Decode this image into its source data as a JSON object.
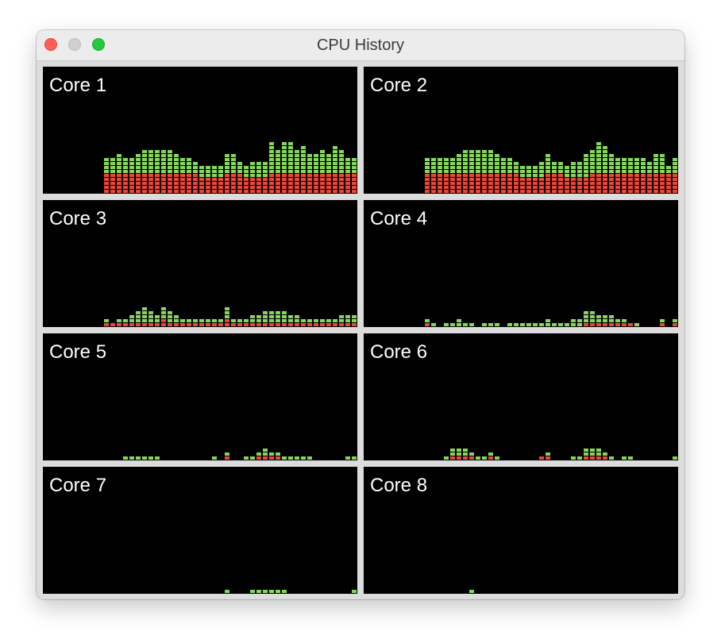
{
  "window": {
    "title": "CPU History"
  },
  "colors": {
    "user": "#86d65a",
    "system": "#e8473a",
    "background": "#000000"
  },
  "cores": [
    {
      "label": "Core 1",
      "system": [
        0,
        0,
        0,
        0,
        0,
        0,
        0,
        0,
        0,
        0,
        0,
        5,
        5,
        5,
        5,
        5,
        5,
        5,
        5,
        5,
        5,
        5,
        5,
        5,
        5,
        5,
        4,
        4,
        4,
        4,
        5,
        5,
        5,
        4,
        4,
        4,
        4,
        5,
        5,
        5,
        5,
        5,
        5,
        5,
        5,
        5,
        5,
        5,
        5,
        5,
        5
      ],
      "user": [
        0,
        0,
        0,
        0,
        0,
        0,
        0,
        0,
        0,
        0,
        0,
        4,
        4,
        5,
        4,
        4,
        5,
        6,
        6,
        6,
        6,
        6,
        5,
        4,
        4,
        3,
        3,
        3,
        3,
        3,
        5,
        5,
        3,
        3,
        4,
        4,
        4,
        8,
        6,
        8,
        8,
        6,
        7,
        5,
        5,
        6,
        5,
        7,
        6,
        4,
        4
      ]
    },
    {
      "label": "Core 2",
      "system": [
        0,
        0,
        0,
        0,
        0,
        0,
        0,
        0,
        0,
        0,
        0,
        5,
        5,
        5,
        5,
        5,
        5,
        5,
        5,
        5,
        5,
        5,
        5,
        5,
        5,
        5,
        4,
        4,
        4,
        4,
        5,
        5,
        5,
        4,
        4,
        4,
        4,
        5,
        5,
        5,
        5,
        5,
        5,
        5,
        5,
        5,
        5,
        5,
        5,
        5,
        5
      ],
      "user": [
        0,
        0,
        0,
        0,
        0,
        0,
        0,
        0,
        0,
        0,
        0,
        4,
        4,
        4,
        4,
        4,
        5,
        6,
        6,
        6,
        6,
        6,
        5,
        4,
        4,
        3,
        3,
        3,
        3,
        4,
        5,
        3,
        3,
        3,
        4,
        4,
        6,
        6,
        8,
        7,
        5,
        4,
        4,
        4,
        4,
        4,
        3,
        5,
        5,
        2,
        4
      ]
    },
    {
      "label": "Core 3",
      "system": [
        0,
        0,
        0,
        0,
        0,
        0,
        0,
        0,
        0,
        0,
        0,
        1,
        1,
        1,
        1,
        1,
        1,
        1,
        1,
        1,
        2,
        1,
        1,
        1,
        1,
        1,
        1,
        1,
        1,
        1,
        2,
        1,
        1,
        1,
        1,
        1,
        1,
        1,
        1,
        1,
        1,
        1,
        1,
        1,
        1,
        1,
        1,
        1,
        1,
        1,
        1
      ],
      "user": [
        0,
        0,
        0,
        0,
        0,
        0,
        0,
        0,
        0,
        0,
        0,
        1,
        0,
        1,
        1,
        2,
        3,
        4,
        3,
        2,
        3,
        3,
        2,
        1,
        1,
        1,
        1,
        1,
        1,
        1,
        3,
        1,
        1,
        1,
        2,
        2,
        3,
        3,
        3,
        3,
        2,
        2,
        1,
        1,
        1,
        1,
        1,
        1,
        2,
        2,
        2
      ]
    },
    {
      "label": "Core 4",
      "system": [
        0,
        0,
        0,
        0,
        0,
        0,
        0,
        0,
        0,
        0,
        0,
        1,
        0,
        0,
        0,
        0,
        0,
        0,
        0,
        0,
        0,
        0,
        0,
        0,
        0,
        0,
        0,
        0,
        0,
        0,
        0,
        0,
        0,
        0,
        0,
        0,
        1,
        1,
        1,
        1,
        1,
        1,
        1,
        1,
        0,
        0,
        0,
        0,
        1,
        0,
        1
      ],
      "user": [
        0,
        0,
        0,
        0,
        0,
        0,
        0,
        0,
        0,
        0,
        0,
        1,
        1,
        0,
        1,
        1,
        2,
        1,
        1,
        0,
        1,
        1,
        1,
        0,
        1,
        1,
        1,
        1,
        1,
        1,
        2,
        1,
        1,
        1,
        2,
        2,
        3,
        3,
        2,
        2,
        2,
        1,
        1,
        0,
        1,
        0,
        0,
        0,
        1,
        0,
        1
      ]
    },
    {
      "label": "Core 5",
      "system": [
        0,
        0,
        0,
        0,
        0,
        0,
        0,
        0,
        0,
        0,
        0,
        0,
        0,
        0,
        0,
        0,
        0,
        0,
        0,
        0,
        0,
        0,
        0,
        0,
        0,
        0,
        0,
        0,
        0,
        0,
        1,
        0,
        0,
        0,
        0,
        1,
        1,
        1,
        1,
        0,
        0,
        0,
        0,
        0,
        0,
        0,
        0,
        0,
        0,
        0,
        0
      ],
      "user": [
        0,
        0,
        0,
        0,
        0,
        0,
        0,
        0,
        0,
        0,
        0,
        0,
        0,
        0,
        1,
        1,
        1,
        1,
        1,
        1,
        0,
        0,
        0,
        0,
        0,
        0,
        0,
        0,
        1,
        0,
        1,
        0,
        0,
        1,
        1,
        1,
        2,
        1,
        1,
        1,
        1,
        1,
        1,
        1,
        0,
        0,
        0,
        0,
        0,
        1,
        1
      ]
    },
    {
      "label": "Core 6",
      "system": [
        0,
        0,
        0,
        0,
        0,
        0,
        0,
        0,
        0,
        0,
        0,
        0,
        0,
        0,
        0,
        1,
        1,
        1,
        1,
        0,
        0,
        1,
        0,
        0,
        0,
        0,
        0,
        0,
        0,
        1,
        1,
        0,
        0,
        0,
        0,
        0,
        1,
        1,
        1,
        1,
        0,
        0,
        0,
        0,
        0,
        0,
        0,
        0,
        0,
        0,
        0
      ],
      "user": [
        0,
        0,
        0,
        0,
        0,
        0,
        0,
        0,
        0,
        0,
        0,
        0,
        0,
        0,
        1,
        2,
        2,
        2,
        1,
        1,
        1,
        1,
        1,
        0,
        0,
        0,
        0,
        0,
        0,
        0,
        1,
        0,
        0,
        0,
        1,
        1,
        2,
        2,
        2,
        1,
        1,
        0,
        1,
        1,
        0,
        0,
        0,
        0,
        0,
        0,
        1
      ]
    },
    {
      "label": "Core 7",
      "system": [
        0,
        0,
        0,
        0,
        0,
        0,
        0,
        0,
        0,
        0,
        0,
        0,
        0,
        0,
        0,
        0,
        0,
        0,
        0,
        0,
        0,
        0,
        0,
        0,
        0,
        0,
        0,
        0,
        0,
        0,
        0,
        0,
        0,
        0,
        0,
        0,
        0,
        0,
        0,
        0,
        0,
        0,
        0,
        0,
        0,
        0,
        0,
        0,
        0,
        0,
        0
      ],
      "user": [
        0,
        0,
        0,
        0,
        0,
        0,
        0,
        0,
        0,
        0,
        0,
        0,
        0,
        0,
        0,
        0,
        0,
        0,
        0,
        0,
        0,
        0,
        0,
        0,
        0,
        0,
        0,
        0,
        0,
        0,
        1,
        0,
        0,
        0,
        1,
        1,
        1,
        1,
        1,
        1,
        0,
        0,
        0,
        0,
        0,
        0,
        0,
        0,
        0,
        0,
        1
      ]
    },
    {
      "label": "Core 8",
      "system": [
        0,
        0,
        0,
        0,
        0,
        0,
        0,
        0,
        0,
        0,
        0,
        0,
        0,
        0,
        0,
        0,
        0,
        0,
        0,
        0,
        0,
        0,
        0,
        0,
        0,
        0,
        0,
        0,
        0,
        0,
        0,
        0,
        0,
        0,
        0,
        0,
        0,
        0,
        0,
        0,
        0,
        0,
        0,
        0,
        0,
        0,
        0,
        0,
        0,
        0,
        0
      ],
      "user": [
        0,
        0,
        0,
        0,
        0,
        0,
        0,
        0,
        0,
        0,
        0,
        0,
        0,
        0,
        0,
        0,
        0,
        0,
        1,
        0,
        0,
        0,
        0,
        0,
        0,
        0,
        0,
        0,
        0,
        0,
        0,
        0,
        0,
        0,
        0,
        0,
        0,
        0,
        0,
        0,
        0,
        0,
        0,
        0,
        0,
        0,
        0,
        0,
        0,
        0,
        0
      ]
    }
  ]
}
